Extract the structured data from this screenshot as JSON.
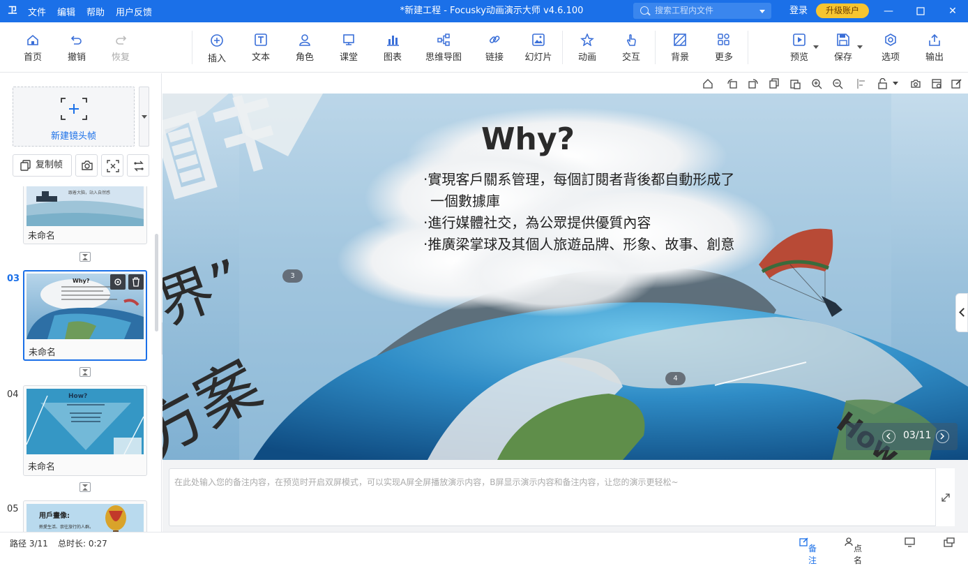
{
  "app": {
    "title": "*新建工程 - Focusky动画演示大师  v4.6.100",
    "menu": [
      "文件",
      "编辑",
      "帮助",
      "用户反馈"
    ],
    "search_placeholder": "搜索工程内文件",
    "login": "登录",
    "upgrade": "升级账户"
  },
  "toolbar": {
    "home": "首页",
    "undo": "撤销",
    "redo": "恢复",
    "insert": "插入",
    "text": "文本",
    "role": "角色",
    "class": "课堂",
    "chart": "图表",
    "mindmap": "思维导图",
    "link": "链接",
    "slideshow": "幻灯片",
    "animation": "动画",
    "interact": "交互",
    "background": "背景",
    "more": "更多",
    "preview": "预览",
    "save": "保存",
    "options": "选项",
    "export": "输出"
  },
  "sidebar": {
    "new_frame": "新建镜头帧",
    "copy_frame": "复制帧",
    "slides": [
      {
        "num": "",
        "name": "未命名",
        "caption": "跟着大脑，站入自然感"
      },
      {
        "num": "03",
        "name": "未命名",
        "title": "Why?"
      },
      {
        "num": "04",
        "name": "未命名",
        "title": "How?"
      },
      {
        "num": "05",
        "name": "",
        "title": "用戶畫像:",
        "caption": "熱愛生活、崇往旅行的人群。"
      }
    ]
  },
  "canvas": {
    "heading": "Why?",
    "bullets": [
      "·實現客戶關系管理，每個訂閱者背後都自動形成了一個數據庫",
      "·進行媒體社交，為公眾提供優質內容",
      "·推廣梁掌球及其個人旅遊品牌、形象、故事、創意"
    ],
    "badge_left": "3",
    "badge_right": "4",
    "bg_text_1": "界”",
    "bg_text_2": "方案",
    "bg_text_3": "How",
    "page_indicator": "03/11"
  },
  "notes": {
    "placeholder": "在此处输入您的备注内容，在预览时开启双屏模式，可以实现A屏全屏播放演示内容，B屏显示演示内容和备注内容，让您的演示更轻松~"
  },
  "status": {
    "path": "路径 3/11",
    "duration": "总时长: 0:27",
    "notes_tab": "备注",
    "rollcall": "点名"
  },
  "colors": {
    "accent": "#1b70e8",
    "upgrade": "#f7c530"
  }
}
